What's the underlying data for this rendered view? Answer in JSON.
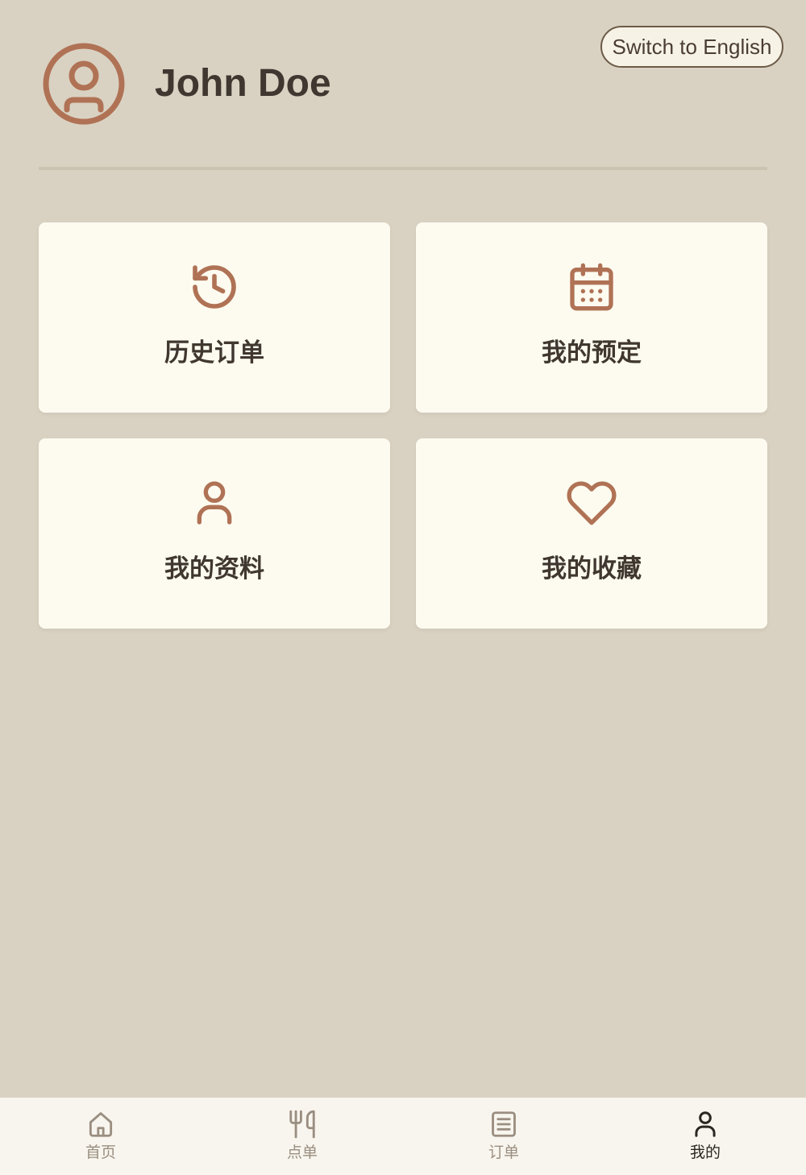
{
  "header": {
    "user_name": "John Doe",
    "language_button": "Switch to English",
    "avatar_icon": "user-circle-icon"
  },
  "menu": {
    "items": [
      {
        "label": "历史订单",
        "icon": "history-icon"
      },
      {
        "label": "我的预定",
        "icon": "calendar-icon"
      },
      {
        "label": "我的资料",
        "icon": "user-icon"
      },
      {
        "label": "我的收藏",
        "icon": "heart-icon"
      }
    ]
  },
  "tabbar": {
    "items": [
      {
        "label": "首页",
        "icon": "home-icon",
        "active": false
      },
      {
        "label": "点单",
        "icon": "utensils-icon",
        "active": false
      },
      {
        "label": "订单",
        "icon": "list-icon",
        "active": false
      },
      {
        "label": "我的",
        "icon": "user-icon",
        "active": true
      }
    ]
  },
  "colors": {
    "background": "#d9d2c2",
    "card_background": "#fdfbf0",
    "accent": "#b07255",
    "text_primary": "#403830",
    "tab_inactive": "#9a8e80",
    "tab_active": "#2a2622",
    "tabbar_background": "#f8f5ee"
  }
}
